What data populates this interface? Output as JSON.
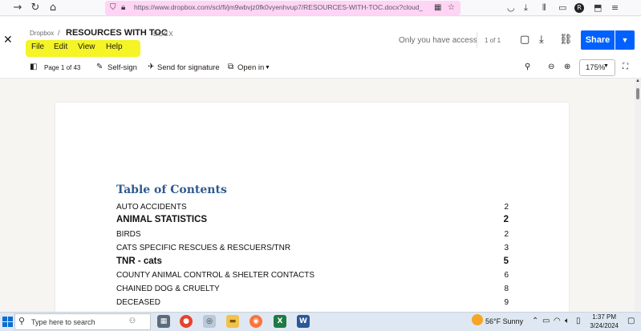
{
  "browser": {
    "url": "https://www.dropbox.com/scl/fi/jm9wbvjz0fk0vyenhvup7/RESOURCES-WITH-TOC.docx?dl=0&rlkey=...",
    "url_display": "https://www.dropbox.com/scl/fi/jm9wbvjz0fk0vyenhvup7/RESOURCES-WITH-TOC.docx?cloud_e",
    "profile_initial": "R",
    "highlight_color": "#f2f200"
  },
  "header": {
    "breadcrumb": "Dropbox",
    "separator": "/",
    "title": "RESOURCES WITH TOC",
    "extension": "DOCX",
    "menu": [
      "File",
      "Edit",
      "View",
      "Help"
    ],
    "access_text": "Only you have access",
    "page_count": "1 of 1",
    "share_label": "Share",
    "share_color": "#0061fe"
  },
  "toolbar": {
    "page_indicator": "Page 1 of 43",
    "self_sign": "Self-sign",
    "send_signature": "Send for signature",
    "open_in": "Open in",
    "zoom": "175%"
  },
  "document": {
    "toc_title": "Table of Contents",
    "toc_title_color": "#2e5a8f",
    "entries": [
      {
        "label": "AUTO ACCIDENTS",
        "page": "2",
        "bold": false
      },
      {
        "label": "ANIMAL STATISTICS",
        "page": "2",
        "bold": true
      },
      {
        "label": "BIRDS",
        "page": "2",
        "bold": false
      },
      {
        "label": "CATS SPECIFIC RESCUES & RESCUERS/TNR",
        "page": "3",
        "bold": false
      },
      {
        "label": "TNR - cats",
        "page": "5",
        "bold": true
      },
      {
        "label": "COUNTY ANIMAL CONTROL & SHELTER CONTACTS",
        "page": "6",
        "bold": false
      },
      {
        "label": "CHAINED DOG & CRUELTY",
        "page": "8",
        "bold": false
      },
      {
        "label": "DECEASED",
        "page": "9",
        "bold": false
      }
    ]
  },
  "taskbar": {
    "search_placeholder": "Type here to search",
    "weather": "56°F  Sunny",
    "time": "1:37 PM",
    "date": "3/24/2024"
  }
}
